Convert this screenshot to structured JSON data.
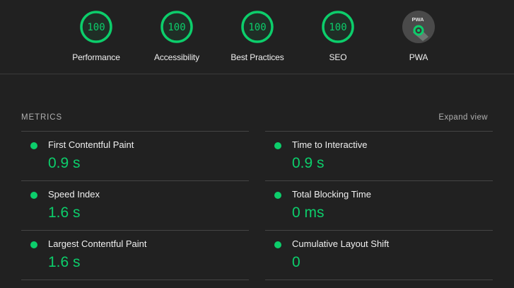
{
  "scores": [
    {
      "label": "Performance",
      "value": "100"
    },
    {
      "label": "Accessibility",
      "value": "100"
    },
    {
      "label": "Best Practices",
      "value": "100"
    },
    {
      "label": "SEO",
      "value": "100"
    }
  ],
  "pwa": {
    "label": "PWA",
    "badge_text": "PWA"
  },
  "metrics_section": {
    "title": "METRICS",
    "expand_label": "Expand view"
  },
  "metrics": {
    "fcp": {
      "name": "First Contentful Paint",
      "value": "0.9 s"
    },
    "tti": {
      "name": "Time to Interactive",
      "value": "0.9 s"
    },
    "si": {
      "name": "Speed Index",
      "value": "1.6 s"
    },
    "tbt": {
      "name": "Total Blocking Time",
      "value": "0 ms"
    },
    "lcp": {
      "name": "Largest Contentful Paint",
      "value": "1.6 s"
    },
    "cls": {
      "name": "Cumulative Layout Shift",
      "value": "0"
    }
  },
  "colors": {
    "pass": "#0cce6b",
    "background": "#212121"
  }
}
